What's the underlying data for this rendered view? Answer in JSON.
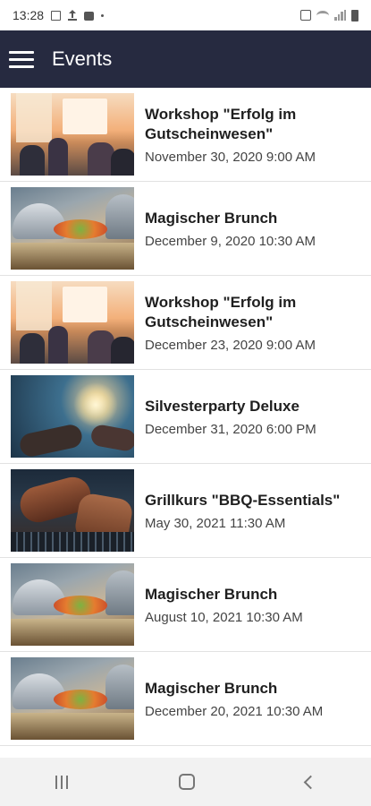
{
  "status_bar": {
    "time": "13:28"
  },
  "app_bar": {
    "title": "Events"
  },
  "events": [
    {
      "title": "Workshop \"Erfolg im Gutscheinwesen\"",
      "date": "November 30, 2020 9:00 AM",
      "image": "workshop"
    },
    {
      "title": "Magischer Brunch",
      "date": "December 9, 2020 10:30 AM",
      "image": "brunch"
    },
    {
      "title": "Workshop \"Erfolg im Gutscheinwesen\"",
      "date": "December 23, 2020 9:00 AM",
      "image": "workshop"
    },
    {
      "title": "Silvesterparty Deluxe",
      "date": "December 31, 2020 6:00 PM",
      "image": "party"
    },
    {
      "title": "Grillkurs \"BBQ-Essentials\"",
      "date": "May 30, 2021 11:30 AM",
      "image": "bbq"
    },
    {
      "title": "Magischer Brunch",
      "date": "August 10, 2021 10:30 AM",
      "image": "brunch"
    },
    {
      "title": "Magischer Brunch",
      "date": "December 20, 2021 10:30 AM",
      "image": "brunch"
    }
  ],
  "colors": {
    "app_bar": "#262a40",
    "title_text": "#1f1f1f",
    "date_text": "#444444",
    "divider": "#e2e2e2"
  },
  "icons": {
    "menu": "hamburger-icon",
    "nav_recent": "recent-apps-icon",
    "nav_home": "home-icon",
    "nav_back": "back-icon"
  }
}
